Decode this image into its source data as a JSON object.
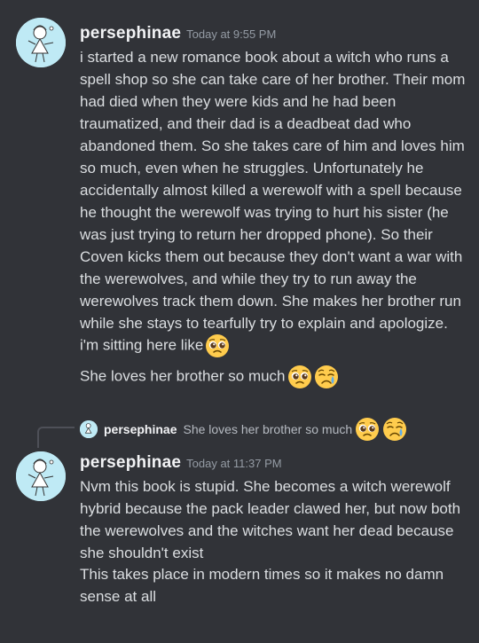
{
  "messages": [
    {
      "username": "persephinae",
      "timestamp": "Today at 9:55 PM",
      "text": "i started a new romance book about a witch who runs a spell shop so she can take care of her brother.  Their mom had died when they were kids and he had been traumatized, and their dad is a deadbeat dad who abandoned them.  So she takes care of him and loves him so much, even when he struggles.  Unfortunately he accidentally almost killed a werewolf with a spell because he thought the werewolf was trying to hurt his sister (he was just trying to return her dropped phone).  So their Coven kicks them out because they don't want a war with the werewolves, and while they try to run away the werewolves track them down.  She makes her brother run while she stays to tearfully try to explain and apologize.",
      "followups": [
        {
          "text": "i'm sitting here like",
          "emojis": [
            "pleading-face"
          ]
        },
        {
          "text": "She loves her brother so much",
          "emojis": [
            "pleading-face",
            "crying-face"
          ]
        }
      ]
    },
    {
      "reply": {
        "username": "persephinae",
        "text": "She loves her brother so much",
        "emojis": [
          "pleading-face",
          "crying-face"
        ]
      },
      "username": "persephinae",
      "timestamp": "Today at 11:37 PM",
      "text": "Nvm this book is stupid.  She becomes a witch werewolf hybrid because the pack leader clawed her, but now both the werewolves and the witches want her dead because she shouldn't exist",
      "followup": "This takes place in modern times so it makes no damn sense at all"
    }
  ],
  "colors": {
    "background": "#313338",
    "username": "#f2f3f5",
    "timestamp": "#949ba4",
    "text": "#dbdee1",
    "avatar_bg": "#bfeaf5"
  }
}
